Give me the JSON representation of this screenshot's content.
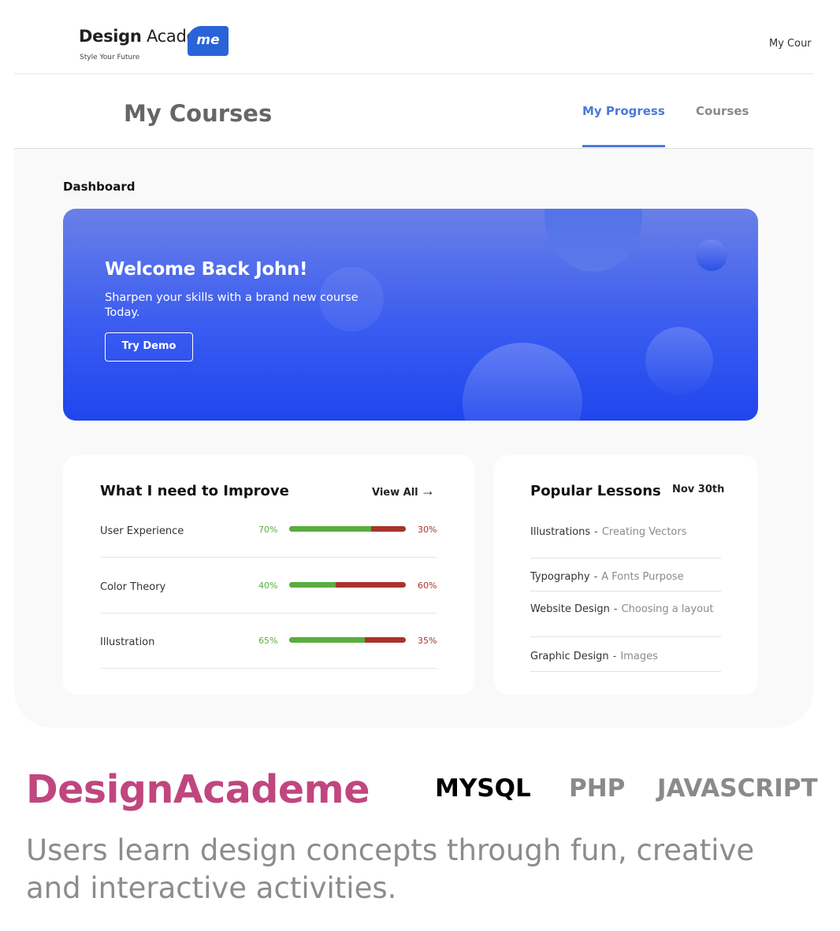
{
  "app": {
    "logo": {
      "text_bold": "Design",
      "text_light": "Acade",
      "badge": "me",
      "tagline": "Style Your Future"
    },
    "top_nav_item": "My Cour"
  },
  "subheader": {
    "title": "My Courses",
    "tabs": [
      {
        "label": "My Progress",
        "active": true
      },
      {
        "label": "Courses",
        "active": false
      }
    ]
  },
  "dashboard": {
    "label": "Dashboard",
    "hero": {
      "title": "Welcome Back John!",
      "subtitle": "Sharpen your skills with a brand new course Today.",
      "button": "Try Demo"
    },
    "improve": {
      "title": "What I need to Improve",
      "view_all": "View All",
      "arrow": "→",
      "items": [
        {
          "label": "User Experience",
          "good": "70%",
          "bad": "30%",
          "good_fraction": 0.7
        },
        {
          "label": "Color Theory",
          "good": "40%",
          "bad": "60%",
          "good_fraction": 0.4
        },
        {
          "label": "Illustration",
          "good": "65%",
          "bad": "35%",
          "good_fraction": 0.65
        }
      ]
    },
    "popular": {
      "title": "Popular Lessons",
      "date": "Nov 30th",
      "separator": "-",
      "lessons": [
        {
          "name": "Illustrations",
          "topic": "Creating Vectors"
        },
        {
          "name": "Typography",
          "topic": "A Fonts Purpose"
        },
        {
          "name": "Website Design",
          "topic": "Choosing a layout"
        },
        {
          "name": "Graphic Design",
          "topic": "Images"
        }
      ]
    }
  },
  "project": {
    "name": "DesignAcademe",
    "tech": [
      "MYSQL",
      "PHP",
      "JAVASCRIPT"
    ],
    "description": "Users learn design concepts through fun, creative and interactive activities."
  },
  "colors": {
    "accent": "#4a7ad8",
    "hero_blue": "#1f46ee",
    "progress_good": "#5aad3f",
    "progress_bad": "#a8342c",
    "project_name": "#c0467f"
  }
}
